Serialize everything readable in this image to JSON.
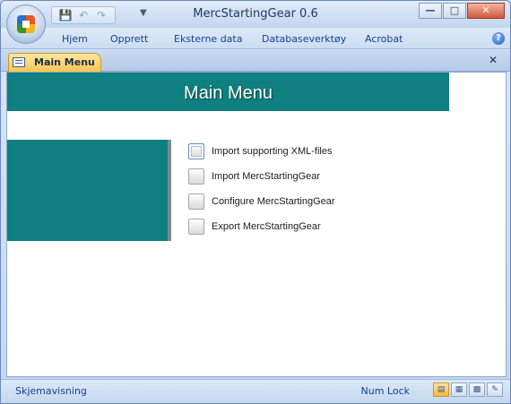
{
  "window": {
    "title": "MercStartingGear 0.6",
    "controls": [
      "minimize-icon",
      "maximize-icon",
      "close-icon"
    ]
  },
  "quick_access": {
    "icons": [
      "save-icon",
      "undo-icon",
      "redo-icon",
      "customize-icon"
    ]
  },
  "ribbon": {
    "tabs": [
      "Hjem",
      "Opprett",
      "Eksterne data",
      "Databaseverktøy",
      "Acrobat"
    ]
  },
  "document": {
    "tab_label": "Main Menu"
  },
  "form": {
    "title": "Main Menu",
    "accent_color": "#0f7f80",
    "items": [
      {
        "label": "Import supporting XML-files",
        "focused": true
      },
      {
        "label": "Import MercStartingGear",
        "focused": false
      },
      {
        "label": "Configure MercStartingGear",
        "focused": false
      },
      {
        "label": "Export MercStartingGear",
        "focused": false
      }
    ]
  },
  "status": {
    "view_name": "Skjemavisning",
    "num_lock": "Num Lock",
    "view_buttons": [
      "form-view-icon",
      "datasheet-view-icon",
      "layout-view-icon",
      "design-view-icon"
    ]
  }
}
